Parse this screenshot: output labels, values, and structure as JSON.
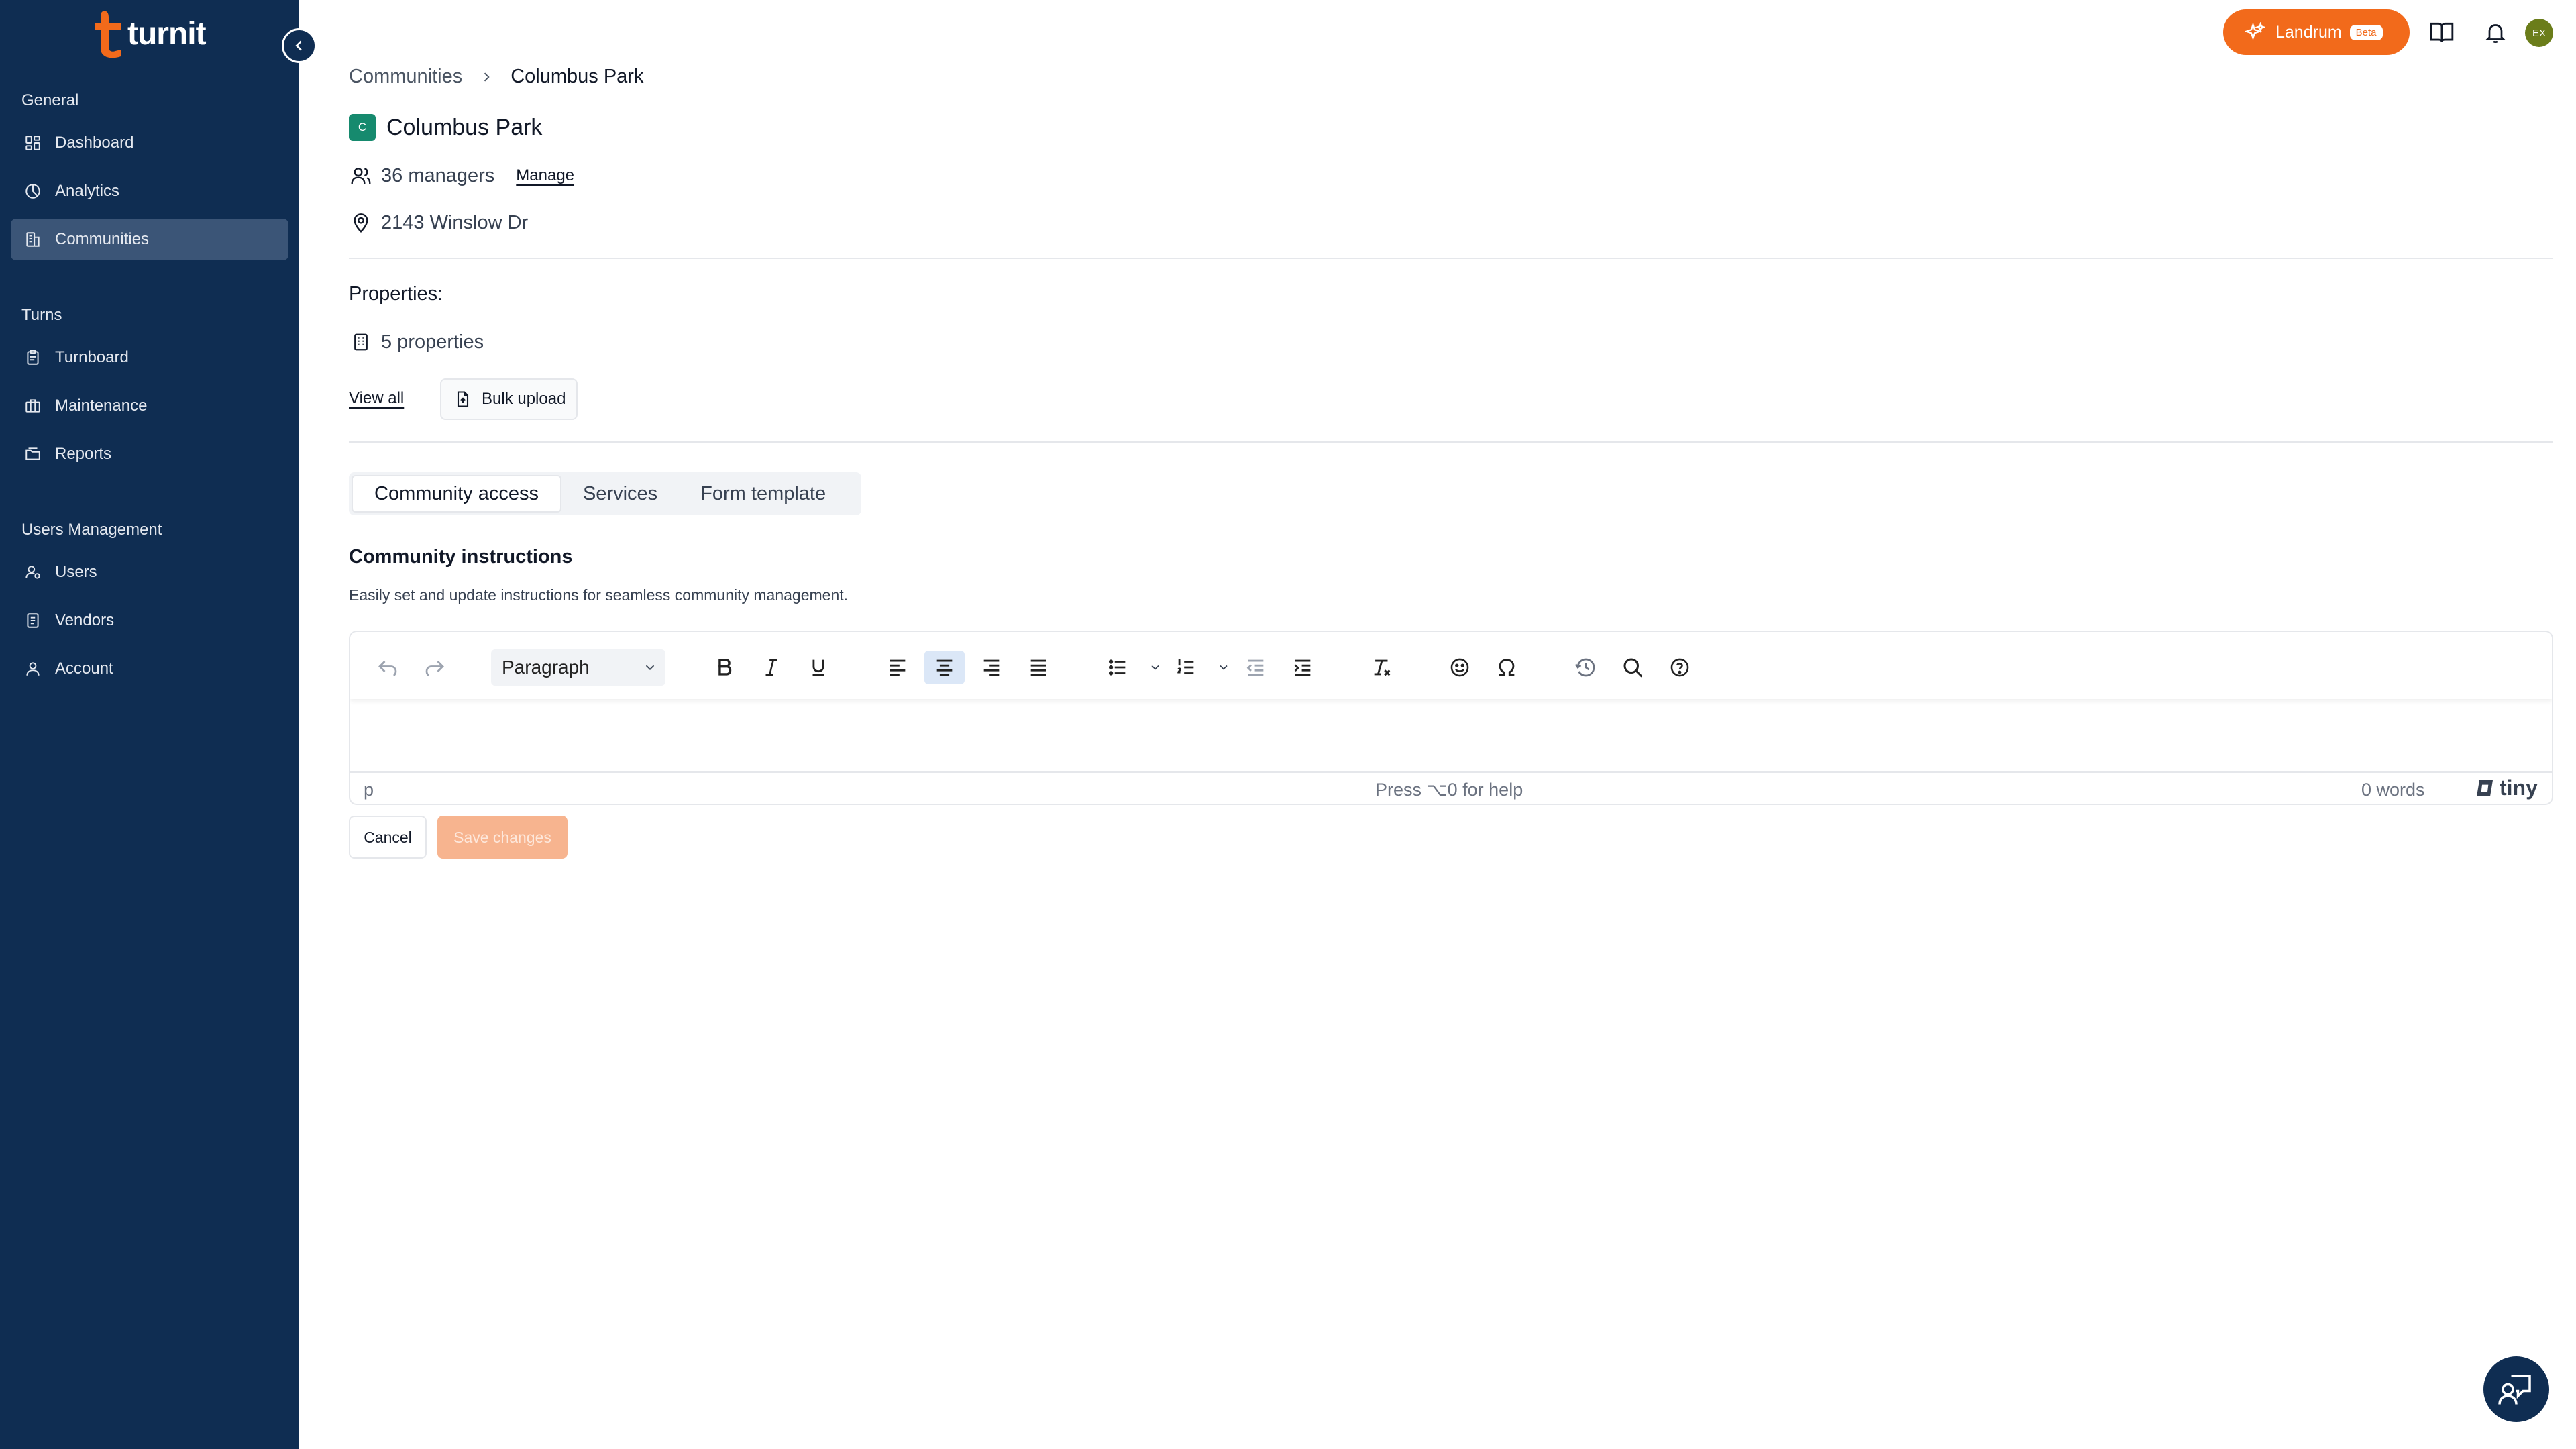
{
  "brand": {
    "name": "turnit",
    "accent": "#f26a1b",
    "sidebar_bg": "#0f2d52"
  },
  "sidebar": {
    "sections": [
      {
        "label": "General",
        "items": [
          {
            "label": "Dashboard",
            "icon": "dashboard-icon"
          },
          {
            "label": "Analytics",
            "icon": "analytics-icon"
          },
          {
            "label": "Communities",
            "icon": "communities-icon",
            "active": true
          }
        ]
      },
      {
        "label": "Turns",
        "items": [
          {
            "label": "Turnboard",
            "icon": "clipboard-icon"
          },
          {
            "label": "Maintenance",
            "icon": "toolbox-icon"
          },
          {
            "label": "Reports",
            "icon": "reports-icon"
          }
        ]
      },
      {
        "label": "Users Management",
        "items": [
          {
            "label": "Users",
            "icon": "user-settings-icon"
          },
          {
            "label": "Vendors",
            "icon": "vendors-icon"
          },
          {
            "label": "Account",
            "icon": "account-icon"
          }
        ]
      }
    ]
  },
  "topbar": {
    "assistant_label": "Landrum",
    "assistant_badge": "Beta",
    "avatar_initials": "EX"
  },
  "breadcrumb": {
    "parent": "Communities",
    "current": "Columbus Park"
  },
  "community": {
    "badge": "C",
    "name": "Columbus Park",
    "managers": "36 managers",
    "manage_link": "Manage",
    "address": "2143 Winslow Dr"
  },
  "properties": {
    "label": "Properties:",
    "count": "5 properties",
    "view_all": "View all",
    "bulk_upload": "Bulk upload"
  },
  "tabs": [
    {
      "label": "Community access",
      "active": true
    },
    {
      "label": "Services",
      "active": false
    },
    {
      "label": "Form template",
      "active": false
    }
  ],
  "instructions": {
    "title": "Community instructions",
    "description": "Easily set and update instructions for seamless community management."
  },
  "editor": {
    "block_format": "Paragraph",
    "path": "p",
    "help": "Press ⌥0 for help",
    "word_count": "0 words",
    "brand": "tiny",
    "active_alignment": "center"
  },
  "actions": {
    "cancel": "Cancel",
    "save": "Save changes"
  }
}
